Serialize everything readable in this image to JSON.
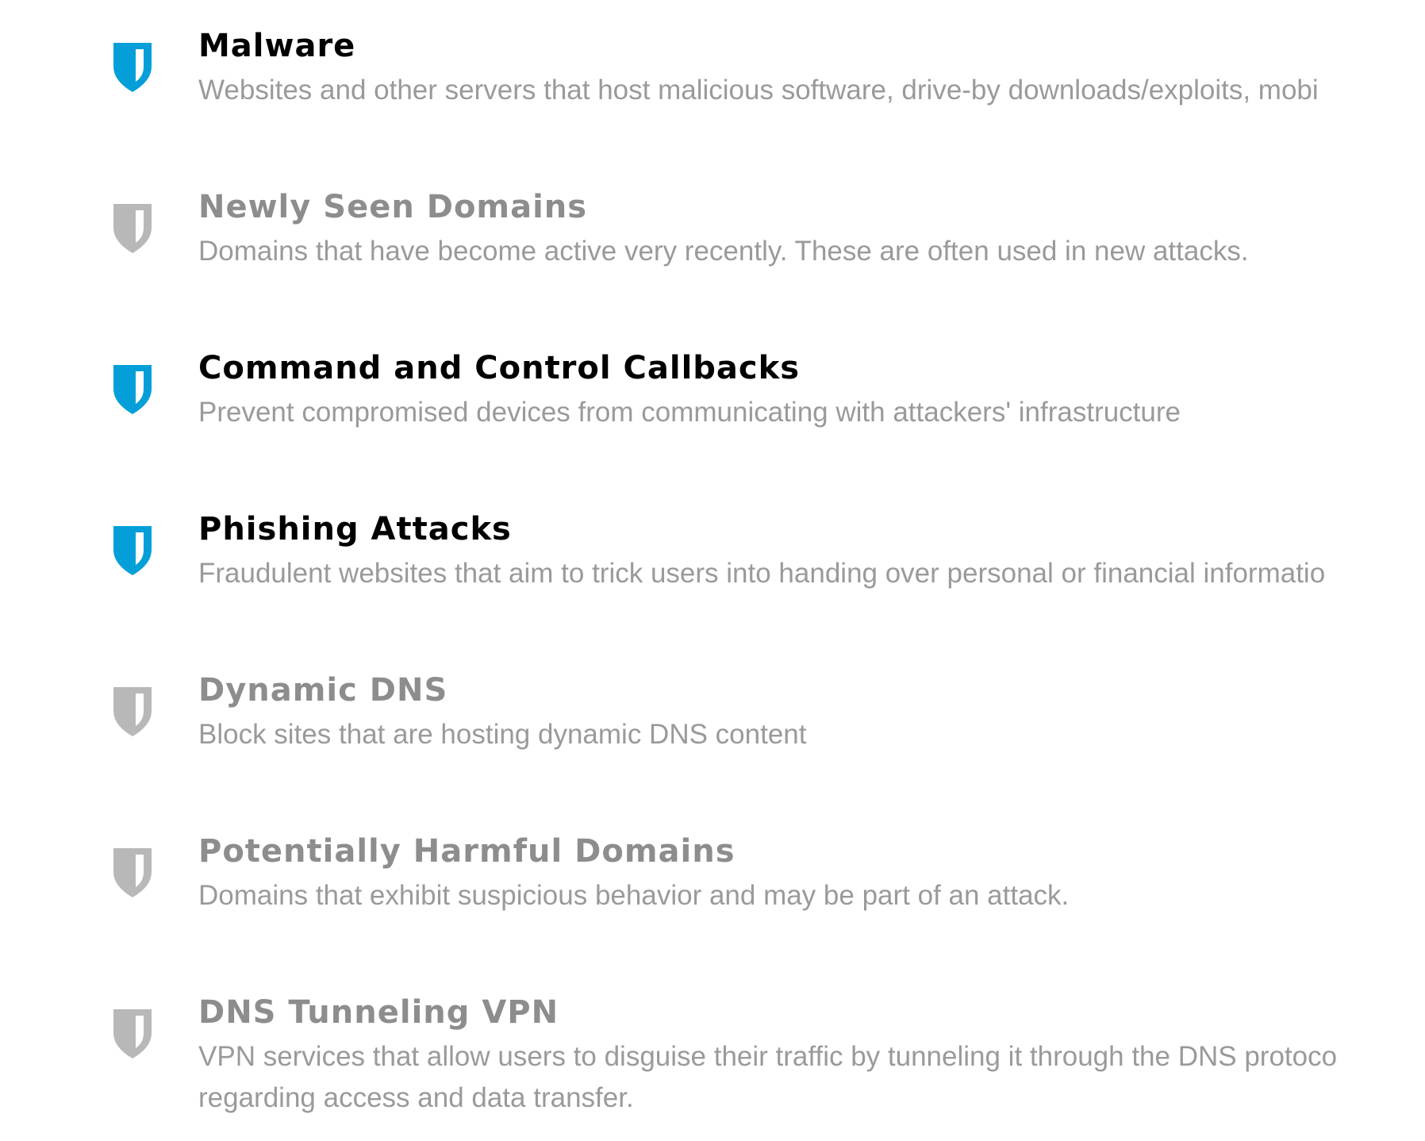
{
  "colors": {
    "shield_enabled": "#049fd9",
    "shield_disabled": "#b8b8b8",
    "title_enabled": "#000000",
    "title_disabled": "#8d8d8d",
    "description": "#9a9a9a"
  },
  "categories": [
    {
      "title": "Malware",
      "description": "Websites and other servers that host malicious software, drive-by downloads/exploits, mobi",
      "enabled": true,
      "icon": "shield-icon"
    },
    {
      "title": "Newly Seen Domains",
      "description": "Domains that have become active very recently. These are often used in new attacks.",
      "enabled": false,
      "icon": "shield-icon"
    },
    {
      "title": "Command and Control Callbacks",
      "description": "Prevent compromised devices from communicating with attackers' infrastructure",
      "enabled": true,
      "icon": "shield-icon"
    },
    {
      "title": "Phishing Attacks",
      "description": "Fraudulent websites that aim to trick users into handing over personal or financial informatio",
      "enabled": true,
      "icon": "shield-icon"
    },
    {
      "title": "Dynamic DNS",
      "description": "Block sites that are hosting dynamic DNS content",
      "enabled": false,
      "icon": "shield-icon"
    },
    {
      "title": "Potentially Harmful Domains",
      "description": "Domains that exhibit suspicious behavior and may be part of an attack.",
      "enabled": false,
      "icon": "shield-icon"
    },
    {
      "title": "DNS Tunneling VPN",
      "description_lines": [
        "VPN services that allow users to disguise their traffic by tunneling it through the DNS protoco",
        "regarding access and data transfer."
      ],
      "enabled": false,
      "icon": "shield-icon"
    }
  ]
}
